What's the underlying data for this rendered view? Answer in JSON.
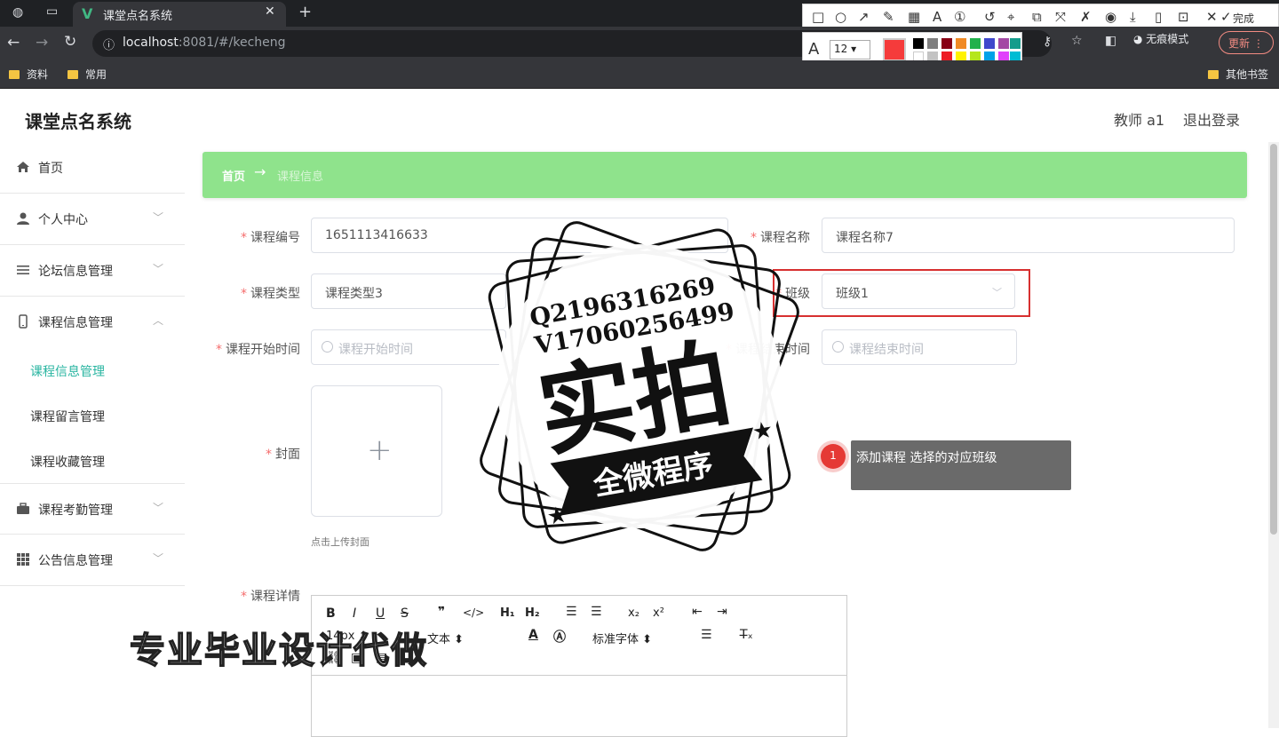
{
  "browser": {
    "tab_title": "课堂点名系统",
    "url_host": "localhost",
    "url_rest": ":8081/#/kecheng",
    "bookmarks": [
      "资料",
      "常用"
    ],
    "other_bookmarks": "其他书签",
    "incognito": "无痕模式",
    "update": "更新"
  },
  "annotation_toolbar": {
    "done_label": "完成",
    "font_size": "12"
  },
  "app": {
    "title": "课堂点名系统",
    "user": "教师 a1",
    "logout": "退出登录"
  },
  "sidebar": {
    "items": [
      {
        "label": "首页",
        "icon": "home-icon"
      },
      {
        "label": "个人中心",
        "icon": "user-icon"
      },
      {
        "label": "论坛信息管理",
        "icon": "list-icon"
      },
      {
        "label": "课程信息管理",
        "icon": "phone-icon"
      },
      {
        "label": "课程考勤管理",
        "icon": "briefcase-icon"
      },
      {
        "label": "公告信息管理",
        "icon": "grid-icon"
      }
    ],
    "submenu": [
      "课程信息管理",
      "课程留言管理",
      "课程收藏管理"
    ]
  },
  "breadcrumb": {
    "home": "首页",
    "arrow": "→",
    "current": "课程信息"
  },
  "form": {
    "code_label": "课程编号",
    "code_value": "1651113416633",
    "name_label": "课程名称",
    "name_value": "课程名称7",
    "type_label": "课程类型",
    "type_value": "课程类型3",
    "class_label": "班级",
    "class_value": "班级1",
    "start_label": "课程开始时间",
    "start_placeholder": "课程开始时间",
    "end_label": "课程结束时间",
    "end_placeholder": "课程结束时间",
    "cover_label": "封面",
    "cover_tip": "点击上传封面",
    "detail_label": "课程详情"
  },
  "editor": {
    "font_size": "14px",
    "paragraph": "文本",
    "font_family": "标准字体"
  },
  "tooltip": {
    "step": "1",
    "text": "添加课程 选择的对应班级"
  },
  "watermark": {
    "qq": "Q2196316269",
    "wechat": "V17060256499",
    "big": "实拍",
    "banner": "全微程序",
    "bottom": "专业毕业设计代做"
  }
}
